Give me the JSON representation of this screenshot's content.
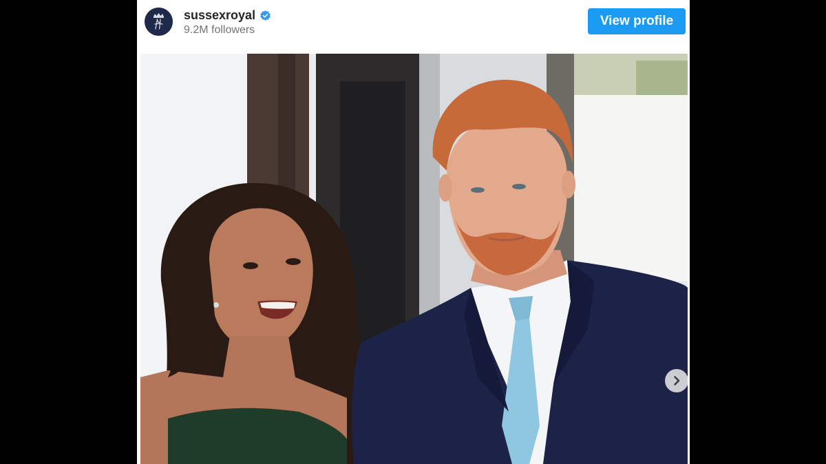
{
  "post_header": {
    "username": "sussexroyal",
    "verified": true,
    "followers": "9.2M followers",
    "view_profile_label": "View profile",
    "avatar_icon": "crown-monogram-avatar",
    "verified_icon": "verified-badge-icon"
  },
  "media": {
    "type": "carousel-photo",
    "next_icon": "chevron-right-icon"
  },
  "colors": {
    "button_bg": "#1a9af1",
    "page_bg": "#000000",
    "card_bg": "#ffffff",
    "verified_blue": "#3897f0",
    "avatar_bg": "#1f2a4a"
  }
}
